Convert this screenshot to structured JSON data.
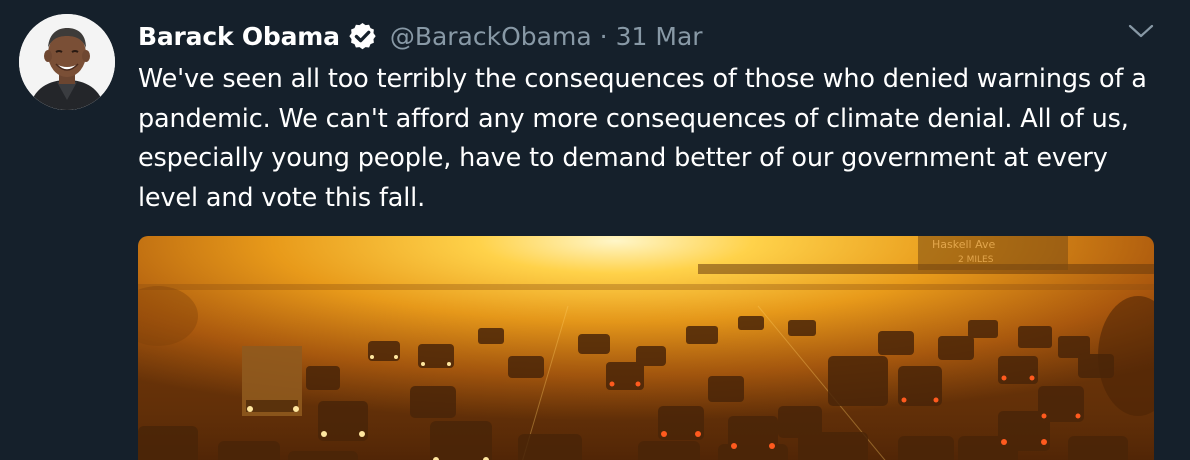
{
  "tweet": {
    "author_name": "Barack Obama",
    "handle": "@BarackObama",
    "separator": "·",
    "date": "31 Mar",
    "text": "We've seen all too terribly the consequences of those who denied warnings of a pandemic. We can't afford any more consequences of climate denial. All of us, especially young people, have to demand better of our government at every level and vote this fall.",
    "media_sign_text": "Haskell Ave",
    "media_sign_subtext": "2 MILES"
  },
  "icons": {
    "verified": "verified-badge-icon",
    "caret": "chevron-down-icon",
    "avatar": "profile-photo"
  },
  "colors": {
    "background": "#15202b",
    "primary_text": "#ffffff",
    "secondary_text": "#8899a6",
    "sky_glow": "#f6b02a"
  }
}
